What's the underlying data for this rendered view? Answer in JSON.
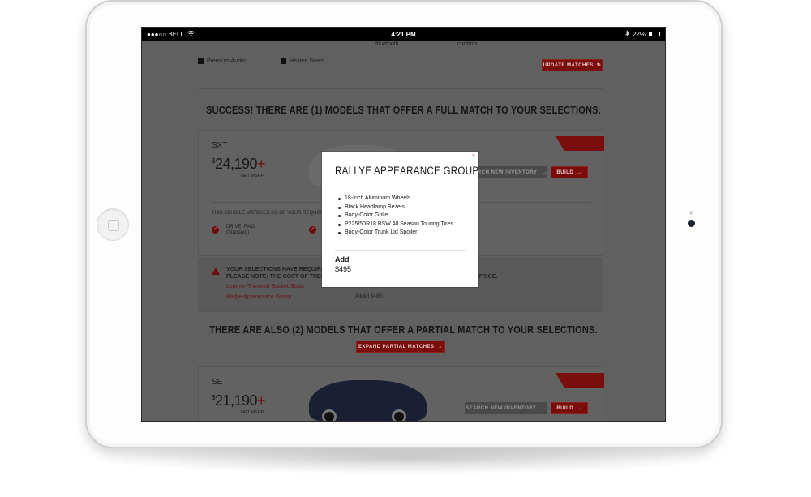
{
  "status_bar": {
    "carrier": "●●●○○ BELL",
    "time": "4:21 PM",
    "battery": "22%"
  },
  "options": {
    "bluetooth_label": "Bluetooth",
    "controls_label": "controls",
    "premium_audio": "Premium Audio",
    "heated_seats": "Heated Seats",
    "update_button": "UPDATE MATCHES"
  },
  "results": {
    "full_match_headline": "SUCCESS! THERE ARE (1) MODELS THAT OFFER A FULL MATCH TO YOUR SELECTIONS.",
    "partial_match_headline": "THERE ARE ALSO (2) MODELS THAT OFFER A PARTIAL MATCH TO YOUR SELECTIONS.",
    "expand_partial_button": "EXPAND PARTIAL MATCHES"
  },
  "card_sxt": {
    "name": "SXT",
    "price_dollar": "$",
    "price": "24,190",
    "plus": "+",
    "msrp_label": "NET MSRP",
    "ribbon": "",
    "search_inventory": "SEARCH NEW INVENTORY",
    "build": "BUILD",
    "matches_text": "THIS VEHICLE MATCHES 2/2 OF YOUR REQUIREMENTS",
    "feature1_title": "DRIVE: FWD",
    "feature1_sub": "(Standard)"
  },
  "warning": {
    "line1": "YOUR SELECTIONS HAVE REQUIRED",
    "line2": "PLEASE NOTE: THE COST OF THESE",
    "line2_end": "PRICE.",
    "link1": "Leather-Trimmed Bucket Seats",
    "link2": "Rallye Appearance Group",
    "added_price": "(Added $495)"
  },
  "card_se": {
    "name": "SE",
    "price_dollar": "$",
    "price": "21,190",
    "plus": "+",
    "msrp_label": "NET MSRP",
    "search_inventory": "SEARCH NEW INVENTORY",
    "build": "BUILD"
  },
  "modal": {
    "close": "×",
    "title": "RALLYE APPEARANCE GROUP",
    "items": [
      "18-Inch Aluminum Wheels",
      "Black Headlamp Bezels",
      "Body-Color Grille",
      "P225/50R18 BSW All Season Touring Tires",
      "Body-Color Trunk Lid Spoiler"
    ],
    "add_label": "Add",
    "price": "$495"
  }
}
